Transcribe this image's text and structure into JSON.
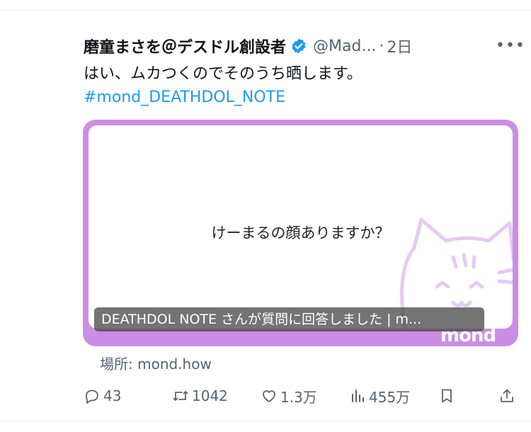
{
  "tweet": {
    "author_name": "磨童まさを＠デスドル創設者",
    "handle": "@Mad...",
    "separator": "·",
    "time": "2日",
    "more_label": "•••",
    "text": "はい、ムカつくのでそのうち晒します。",
    "hashtag": "#mond_DEATHDOL_NOTE"
  },
  "card": {
    "question": "けーまるの顔ありますか？",
    "caption": "DEATHDOL NOTE さんが質問に回答しました | m...",
    "logo_text": "mond",
    "source": "場所: mond.how"
  },
  "actions": {
    "replies": "43",
    "retweets": "1042",
    "likes": "1.3万",
    "views": "455万"
  },
  "colors": {
    "accent": "#1d9bf0",
    "card_border": "#cb8ee6",
    "muted": "#536471"
  }
}
